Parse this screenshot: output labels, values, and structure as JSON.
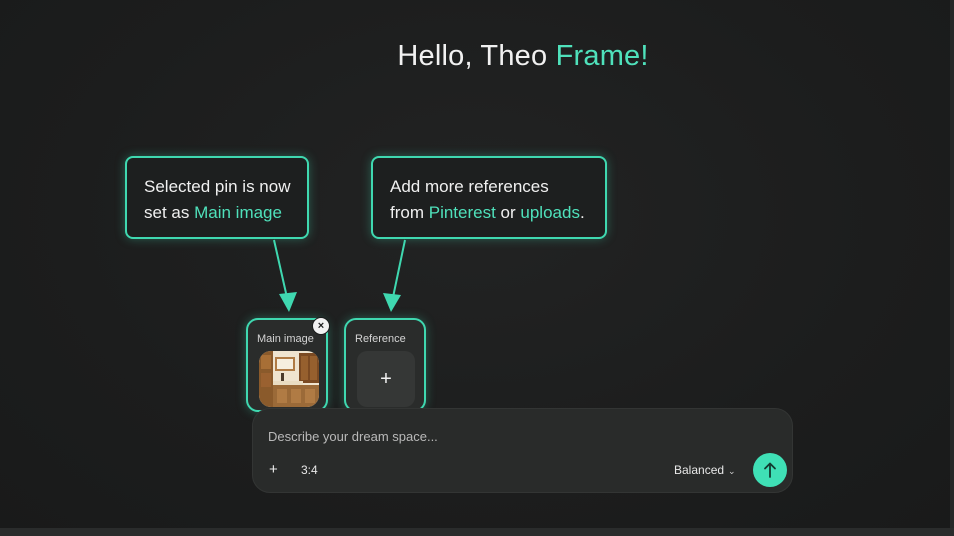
{
  "greeting": {
    "prefix": "Hello, Theo ",
    "accent": "Frame!"
  },
  "callouts": {
    "main": {
      "line1": "Selected pin is now",
      "line2_prefix": "set as ",
      "line2_accent": "Main image"
    },
    "reference": {
      "line1": "Add more references",
      "line2_prefix": "from ",
      "line2_accent1": "Pinterest",
      "line2_middle": " or ",
      "line2_accent2": "uploads",
      "line2_suffix": "."
    }
  },
  "cards": {
    "main": {
      "label": "Main image",
      "remove_icon": "×"
    },
    "reference": {
      "label": "Reference",
      "add_icon": "+"
    }
  },
  "composer": {
    "placeholder": "Describe your dream space...",
    "add_icon": "+",
    "aspect_ratio": "3:4",
    "mode": "Balanced",
    "mode_chevron": "⌄"
  },
  "colors": {
    "accent": "#3fd8b0",
    "background": "#1b1c1c",
    "surface": "#292b2a"
  }
}
